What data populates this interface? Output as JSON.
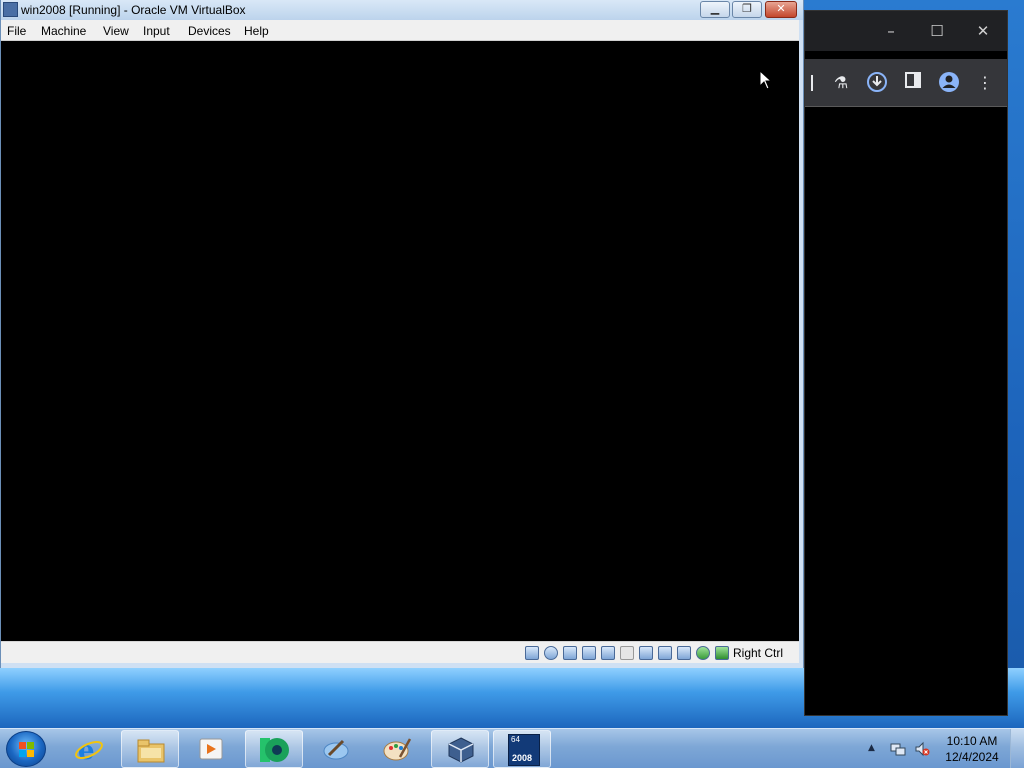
{
  "vbox": {
    "title": "win2008 [Running] - Oracle VM VirtualBox",
    "menu": [
      "File",
      "Machine",
      "View",
      "Input",
      "Devices",
      "Help"
    ],
    "status_host_key": "Right Ctrl",
    "status_icons": [
      "hard-disk-icon",
      "optical-drive-icon",
      "audio-icon",
      "network-icon",
      "usb-icon",
      "shared-folders-icon",
      "display-icon",
      "video-capture-icon",
      "vbox-extension-icon",
      "globe-icon",
      "mouse-integration-icon"
    ]
  },
  "chrome": {
    "toolbar_icons": [
      "flask-icon",
      "download-icon",
      "side-panel-icon",
      "profile-icon",
      "menu-dots-icon"
    ]
  },
  "taskbar": {
    "apps": [
      "internet-explorer-icon",
      "file-explorer-icon",
      "media-player-icon",
      "chrome-canary-icon",
      "app-icon-5",
      "paint-icon",
      "virtualbox-icon",
      "win2008-vm-icon"
    ],
    "vm_badge_top": "64",
    "vm_badge_bottom": "2008",
    "clock_time": "10:10 AM",
    "clock_date": "12/4/2024"
  },
  "colors": {
    "desktop": "#1d64bb",
    "taskbar": "#7ea7d6",
    "vm_screen": "#000000",
    "chrome_toolbar": "#35363a"
  }
}
